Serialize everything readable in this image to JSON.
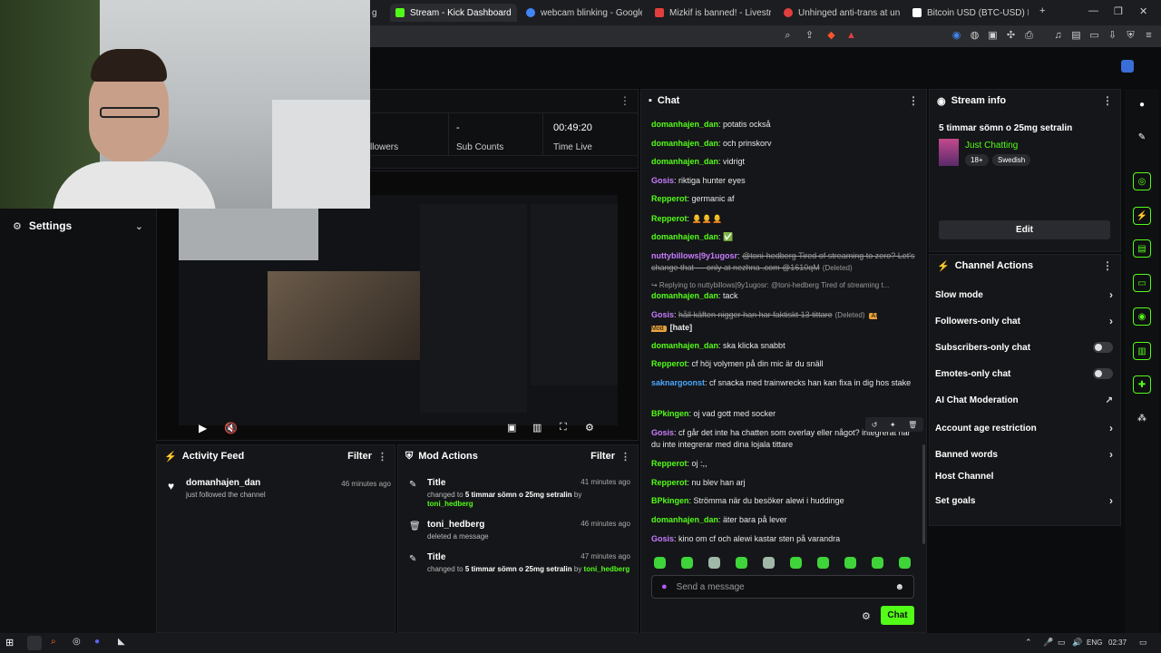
{
  "browser": {
    "tabs": [
      {
        "title": "Stream - Kick Dashboard",
        "color": "#53fc18",
        "active": true
      },
      {
        "title": "webcam blinking - Google Sea",
        "color": "#4285f4",
        "active": false
      },
      {
        "title": "Mizkif is banned! - LivestreamF",
        "color": "#e33e3e",
        "active": false
      },
      {
        "title": "Unhinged anti-trans at unf$%",
        "color": "#e33e3e",
        "active": false
      },
      {
        "title": "Bitcoin USD (BTC-USD) Price H",
        "color": "#ffffff",
        "active": false
      }
    ],
    "partial_tab": "g"
  },
  "stats": {
    "followers_label": "llowers",
    "sub_counts_value": "-",
    "sub_counts_label": "Sub Counts",
    "time_live_value": "00:49:20",
    "time_live_label": "Time Live"
  },
  "settings": {
    "title": "Settings"
  },
  "activity_feed": {
    "title": "Activity Feed",
    "filter": "Filter",
    "items": [
      {
        "user": "domanhajen_dan",
        "text": "just followed the channel",
        "time": "46 minutes ago"
      }
    ]
  },
  "mod_actions": {
    "title": "Mod Actions",
    "filter": "Filter",
    "items": [
      {
        "title": "Title",
        "pre": "changed to ",
        "value": "5 timmar sömn o 25mg setralin",
        "mid": " by ",
        "user": "toni_hedberg",
        "time": "41 minutes ago"
      },
      {
        "title": "toni_hedberg",
        "pre": "deleted a message",
        "value": "",
        "mid": "",
        "user": "",
        "time": "46 minutes ago"
      },
      {
        "title": "Title",
        "pre": "changed to ",
        "value": "5 timmar sömn o 25mg setralin",
        "mid": " by ",
        "user": "toni_hedberg",
        "time": "47 minutes ago"
      }
    ]
  },
  "chat": {
    "title": "Chat",
    "messages": [
      {
        "user": "domanhajen_dan",
        "color": "#53fc18",
        "text": "potatis också"
      },
      {
        "user": "domanhajen_dan",
        "color": "#53fc18",
        "text": "och prinskorv"
      },
      {
        "user": "domanhajen_dan",
        "color": "#53fc18",
        "text": "vidrigt"
      },
      {
        "user": "Gosis",
        "color": "#c77dff",
        "text": "riktiga hunter eyes"
      },
      {
        "user": "Repperot",
        "color": "#53fc18",
        "text": "germanic af"
      },
      {
        "user": "Repperot",
        "color": "#53fc18",
        "text": "🧑‍🦲🧑‍🦲🧑‍🦲"
      },
      {
        "user": "domanhajen_dan",
        "color": "#53fc18",
        "text": "✅"
      },
      {
        "user": "nuttybillows|9y1ugosr",
        "color": "#c77dff",
        "text": "@toni-hedberg Tired of streaming to zero? Let's change that — only at nezhna .com @1610qM",
        "deleted": true,
        "tag": "(Deleted)"
      },
      {
        "user": "",
        "color": "#9a9a9a",
        "text": "↪ Replying to nuttybillows|9y1ugosr: @toni-hedberg Tired of streaming t..."
      },
      {
        "user": "domanhajen_dan",
        "color": "#53fc18",
        "text": "tack"
      },
      {
        "user": "Gosis",
        "color": "#c77dff",
        "text": "håll käften nigger han har faktiskt 13 tittare",
        "deleted": true,
        "tag": "(Deleted)",
        "ai": "AI Mod",
        "extra": "[hate]"
      },
      {
        "user": "domanhajen_dan",
        "color": "#53fc18",
        "text": "ska klicka snabbt"
      },
      {
        "user": "Repperot",
        "color": "#53fc18",
        "text": "cf höj volymen på din mic är du snäll"
      },
      {
        "user": "saknargoonst",
        "color": "#4aa8ff",
        "text": "cf snacka med trainwrecks han kan fixa in dig hos stake"
      },
      {
        "user": "BPkingen",
        "color": "#53fc18",
        "text": "oj vad gott med socker"
      },
      {
        "user": "Gosis",
        "color": "#c77dff",
        "text": "cf går det inte ha chatten som overlay eller något? integrerat när du inte integrerar med dina lojala tittare"
      },
      {
        "user": "Repperot",
        "color": "#53fc18",
        "text": "oj :,,"
      },
      {
        "user": "Repperot",
        "color": "#53fc18",
        "text": "nu blev han arj"
      },
      {
        "user": "BPkingen",
        "color": "#53fc18",
        "text": "Strömma när du besöker alewi i huddinge"
      },
      {
        "user": "domanhajen_dan",
        "color": "#53fc18",
        "text": "äter bara på lever"
      },
      {
        "user": "Gosis",
        "color": "#c77dff",
        "text": "kino om cf och alewi kastar sten på varandra"
      }
    ],
    "input_placeholder": "Send a message",
    "send_label": "Chat"
  },
  "stream_info": {
    "title": "Stream info",
    "stream_title": "5 timmar sömn o 25mg setralin",
    "category": "Just Chatting",
    "tags": [
      "18+",
      "Swedish"
    ],
    "edit_label": "Edit"
  },
  "channel_actions": {
    "title": "Channel Actions",
    "items": [
      {
        "label": "Slow mode",
        "control": "chevron"
      },
      {
        "label": "Followers-only chat",
        "control": "chevron"
      },
      {
        "label": "Subscribers-only chat",
        "control": "toggle"
      },
      {
        "label": "Emotes-only chat",
        "control": "toggle"
      },
      {
        "label": "AI Chat Moderation",
        "control": "external"
      },
      {
        "label": "Account age restriction",
        "control": "chevron"
      },
      {
        "label": "Banned words",
        "control": "chevron"
      },
      {
        "label": "Host Channel",
        "control": "none"
      },
      {
        "label": "Set goals",
        "control": "chevron"
      }
    ]
  },
  "taskbar": {
    "lang": "ENG",
    "time": "02:37"
  },
  "colors": {
    "accent": "#53fc18",
    "panel": "#151619",
    "bg": "#0b0c0e"
  }
}
